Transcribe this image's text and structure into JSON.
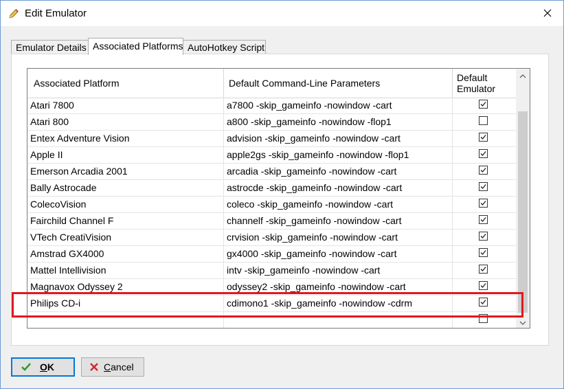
{
  "window": {
    "title": "Edit Emulator"
  },
  "tabs": [
    {
      "label": "Emulator Details",
      "active": false
    },
    {
      "label": "Associated Platforms",
      "active": true
    },
    {
      "label": "AutoHotkey Script",
      "active": false
    }
  ],
  "grid": {
    "columns": [
      "Associated Platform",
      "Default Command-Line Parameters",
      "Default\nEmulator"
    ],
    "column_default_line1": "Default",
    "column_default_line2": "Emulator",
    "rows": [
      {
        "platform": "Atari 7800",
        "params": "a7800 -skip_gameinfo -nowindow -cart",
        "default": true
      },
      {
        "platform": "Atari 800",
        "params": "a800 -skip_gameinfo -nowindow -flop1",
        "default": false
      },
      {
        "platform": "Entex Adventure Vision",
        "params": "advision -skip_gameinfo -nowindow -cart",
        "default": true
      },
      {
        "platform": "Apple II",
        "params": "apple2gs -skip_gameinfo -nowindow -flop1",
        "default": true
      },
      {
        "platform": "Emerson Arcadia 2001",
        "params": "arcadia -skip_gameinfo -nowindow -cart",
        "default": true
      },
      {
        "platform": "Bally Astrocade",
        "params": "astrocde -skip_gameinfo -nowindow -cart",
        "default": true
      },
      {
        "platform": "ColecoVision",
        "params": "coleco -skip_gameinfo -nowindow -cart",
        "default": true
      },
      {
        "platform": "Fairchild Channel F",
        "params": "channelf -skip_gameinfo -nowindow -cart",
        "default": true
      },
      {
        "platform": "VTech CreatiVision",
        "params": "crvision -skip_gameinfo -nowindow -cart",
        "default": true
      },
      {
        "platform": "Amstrad GX4000",
        "params": "gx4000 -skip_gameinfo -nowindow -cart",
        "default": true
      },
      {
        "platform": "Mattel Intellivision",
        "params": "intv -skip_gameinfo -nowindow -cart",
        "default": true
      },
      {
        "platform": "Magnavox Odyssey 2",
        "params": "odyssey2 -skip_gameinfo -nowindow -cart",
        "default": true
      },
      {
        "platform": "Philips CD-i",
        "params": "cdimono1 -skip_gameinfo -nowindow -cdrm",
        "default": true
      },
      {
        "platform": "",
        "params": "",
        "default": false
      }
    ]
  },
  "highlight_color": "#e0191e",
  "buttons": {
    "ok": "OK",
    "cancel": "Cancel"
  },
  "icons": {
    "title": "pencil-icon",
    "close": "close-icon",
    "ok": "check-icon",
    "cancel": "x-icon"
  }
}
